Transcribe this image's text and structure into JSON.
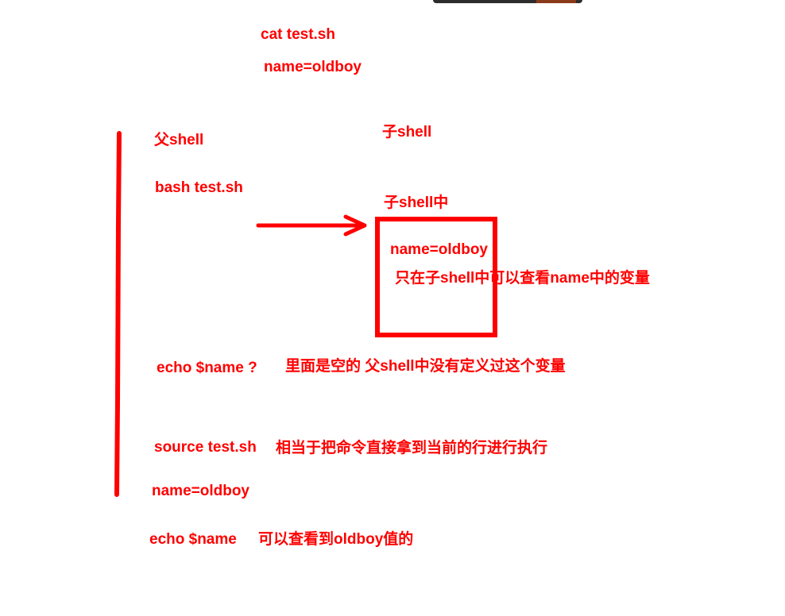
{
  "notes": {
    "cat_cmd": "cat test.sh",
    "name_assign_top": "name=oldboy",
    "parent_shell": "父shell",
    "bash_cmd": "bash test.sh",
    "child_shell": "子shell",
    "in_child_shell": "子shell中",
    "name_assign_box": "name=oldboy",
    "child_only": "只在子shell中可以查看name中的变量",
    "echo_query": "echo $name ?",
    "echo_explain": "里面是空的 父shell中没有定义过这个变量",
    "source_cmd": "source test.sh",
    "source_explain": "相当于把命令直接拿到当前的行进行执行",
    "name_assign_bottom": "name=oldboy",
    "echo_cmd": "echo $name",
    "echo_result": "可以查看到oldboy值的"
  },
  "colors": {
    "annotation": "#ff0000",
    "background": "#ffffff"
  }
}
